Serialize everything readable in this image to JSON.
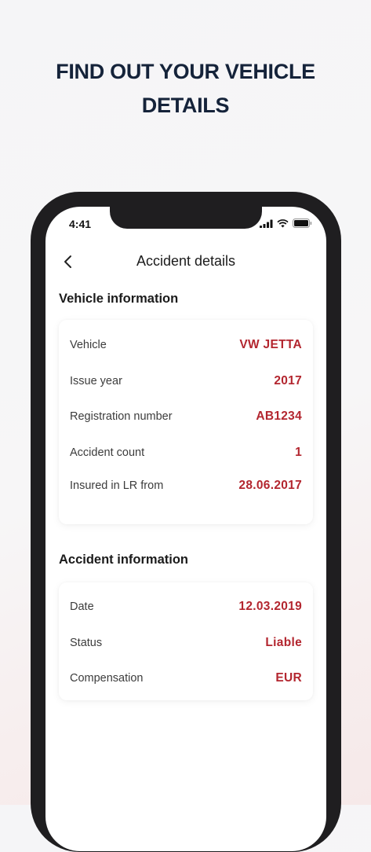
{
  "headline": {
    "line1": "FIND OUT YOUR VEHICLE",
    "line2": "DETAILS"
  },
  "status_bar": {
    "time": "4:41"
  },
  "nav": {
    "title": "Accident details"
  },
  "vehicle_section": {
    "title": "Vehicle information",
    "rows": [
      {
        "label": "Vehicle",
        "value": "VW JETTA"
      },
      {
        "label": "Issue year",
        "value": "2017"
      },
      {
        "label": "Registration number",
        "value": "AB1234"
      },
      {
        "label": "Accident count",
        "value": "1"
      },
      {
        "label": "Insured in LR from",
        "value": "28.06.2017"
      }
    ]
  },
  "accident_section": {
    "title": "Accident information",
    "rows": [
      {
        "label": "Date",
        "value": "12.03.2019"
      },
      {
        "label": "Status",
        "value": "Liable"
      },
      {
        "label": "Compensation",
        "value": "EUR"
      }
    ]
  },
  "colors": {
    "accent": "#b3262f",
    "headline": "#15233a",
    "phone_frame": "#1f1e20"
  }
}
